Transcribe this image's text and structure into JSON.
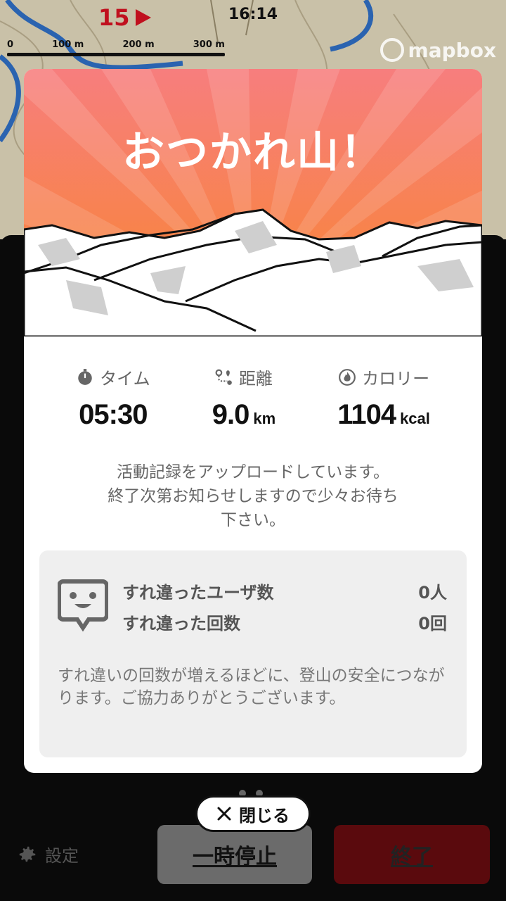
{
  "status_bar": {
    "time": "16:14"
  },
  "map": {
    "pace_value": "15",
    "scale_labels": [
      "0",
      "100 m",
      "200 m",
      "300 m"
    ],
    "attribution": "mapbox"
  },
  "modal": {
    "title": "おつかれ山！",
    "stats": [
      {
        "icon": "stopwatch-icon",
        "label": "タイム",
        "value": "05:30",
        "unit": ""
      },
      {
        "icon": "route-icon",
        "label": "距離",
        "value": "9.0",
        "unit": "km"
      },
      {
        "icon": "flame-icon",
        "label": "カロリー",
        "value": "1104",
        "unit": "kcal"
      }
    ],
    "upload_message_lines": [
      "活動記録をアップロードしています。",
      "終了次第お知らせしますので少々お待ち",
      "下さい。"
    ],
    "passing": {
      "rows": [
        {
          "label": "すれ違ったユーザ数",
          "value": "0人"
        },
        {
          "label": "すれ違った回数",
          "value": "0回"
        }
      ],
      "note": "すれ違いの回数が増えるほどに、登山の安全につながります。ご協力ありがとうございます。"
    }
  },
  "close_button": {
    "label": "閉じる"
  },
  "bottom_bar": {
    "settings_label": "設定",
    "pause_label": "一時停止",
    "end_label": "終了"
  },
  "colors": {
    "accent_red": "#c0101e",
    "hero_gradient_top": "#f77e7e",
    "hero_gradient_bottom": "#f88a2e"
  }
}
